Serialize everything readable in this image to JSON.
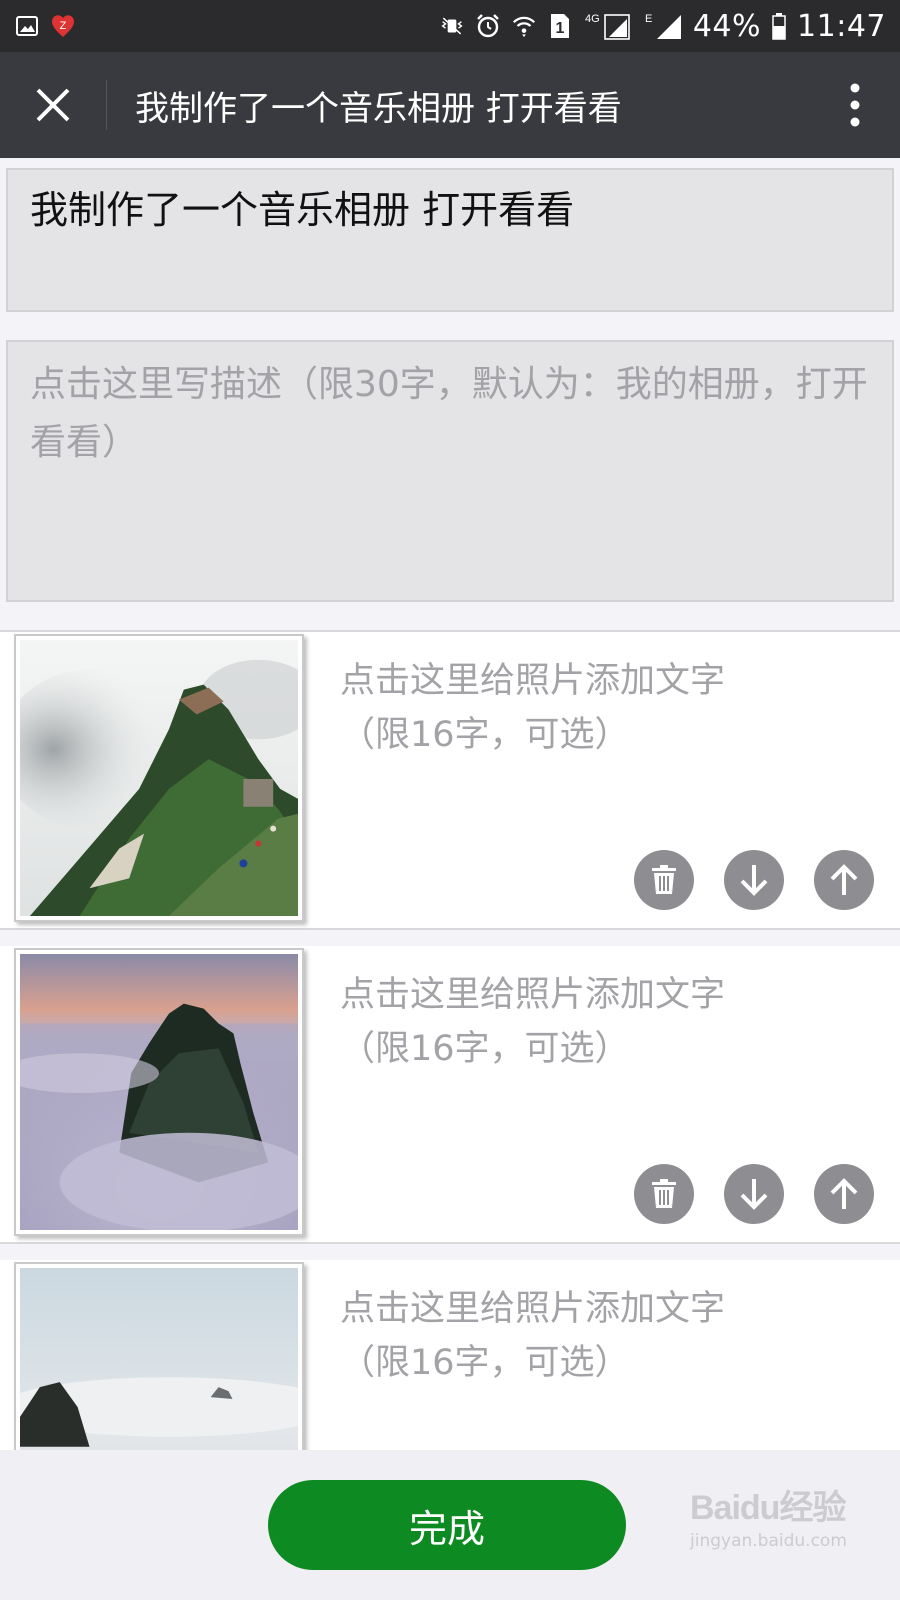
{
  "status_bar": {
    "time": "11:47",
    "battery": "44%",
    "network": "4G",
    "network_e": "E",
    "sim": "1",
    "icons": [
      "image-icon",
      "app-z-icon",
      "vibrate-icon",
      "alarm-icon",
      "wifi-icon",
      "sim-icon",
      "signal-icon",
      "battery-icon"
    ]
  },
  "header": {
    "title": "我制作了一个音乐相册 打开看看",
    "close_icon": "close-icon",
    "more_icon": "more-vert-icon"
  },
  "form": {
    "title_value": "我制作了一个音乐相册  打开看看",
    "description_placeholder": "点击这里写描述（限30字，默认为：我的相册，打开看看）"
  },
  "photos": [
    {
      "caption_placeholder": "点击这里给照片添加文字（限16字，可选）",
      "actions": [
        "delete-icon",
        "move-down-icon",
        "move-up-icon"
      ]
    },
    {
      "caption_placeholder": "点击这里给照片添加文字（限16字，可选）",
      "actions": [
        "delete-icon",
        "move-down-icon",
        "move-up-icon"
      ]
    },
    {
      "caption_placeholder": "点击这里给照片添加文字（限16字，可选）",
      "actions": []
    }
  ],
  "footer": {
    "done_label": "完成"
  },
  "watermark": {
    "logo": "Baidu经验",
    "url": "jingyan.baidu.com"
  },
  "colors": {
    "accent": "#0e8a23",
    "header_bg": "#393a3f",
    "status_bg": "#2b2b2d",
    "placeholder": "#a3a2a6"
  }
}
